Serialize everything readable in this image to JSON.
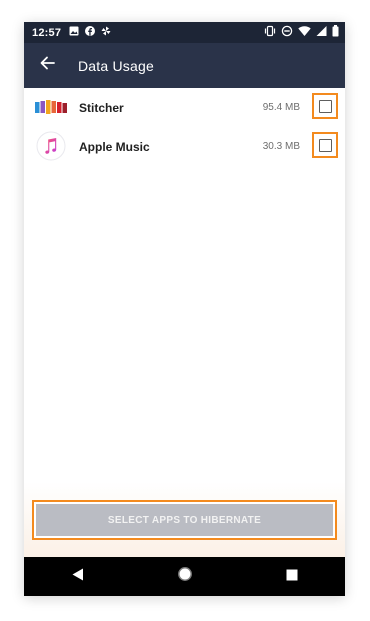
{
  "status_bar": {
    "time": "12:57",
    "left_icons": [
      "image-icon",
      "facebook-icon",
      "pinwheel-icon"
    ],
    "right_icons": [
      "vibrate-icon",
      "do-not-disturb-icon",
      "wifi-icon",
      "signal-icon",
      "battery-icon"
    ]
  },
  "app_bar": {
    "back_icon": "arrow-left-icon",
    "title": "Data Usage"
  },
  "apps": [
    {
      "name": "Stitcher",
      "size": "95.4 MB",
      "icon": "stitcher-icon",
      "checked": false
    },
    {
      "name": "Apple Music",
      "size": "30.3 MB",
      "icon": "apple-music-icon",
      "checked": false
    }
  ],
  "actions": {
    "hibernate_label": "SELECT APPS TO HIBERNATE"
  },
  "nav_bar": {
    "icons": [
      "nav-back-icon",
      "nav-home-icon",
      "nav-recents-icon"
    ]
  },
  "colors": {
    "header": "#2a3349",
    "status_bar": "#1d2536",
    "highlight": "#f38a1e",
    "button_disabled": "#babcc3"
  }
}
